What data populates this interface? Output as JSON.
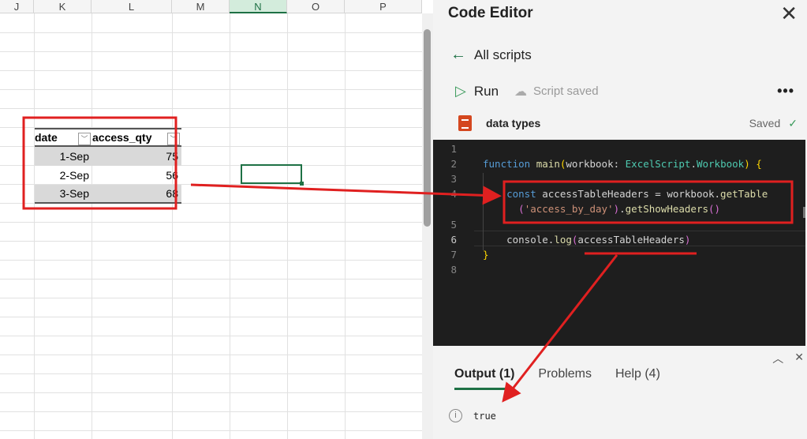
{
  "sheet": {
    "columns": [
      "J",
      "K",
      "L",
      "M",
      "N",
      "O",
      "P"
    ],
    "selected_column": "N",
    "table": {
      "headers": [
        "date",
        "access_qty"
      ],
      "rows": [
        [
          "1-Sep",
          "75"
        ],
        [
          "2-Sep",
          "56"
        ],
        [
          "3-Sep",
          "68"
        ]
      ],
      "filter_icon": "chevron-down-icon"
    }
  },
  "panel": {
    "title": "Code Editor",
    "back_label": "All scripts",
    "run_label": "Run",
    "script_saved_label": "Script saved",
    "more_label": "•••",
    "script_name": "data types",
    "saved_label": "Saved"
  },
  "editor": {
    "line_numbers": [
      "1",
      "2",
      "3",
      "4",
      "5",
      "6",
      "7",
      "8"
    ]
  },
  "output": {
    "tabs": [
      "Output (1)",
      "Problems",
      "Help (4)"
    ],
    "result": "true"
  },
  "colors": {
    "accent": "#1e7145",
    "annotation": "#e02020",
    "editor_bg": "#1e1e1e"
  }
}
